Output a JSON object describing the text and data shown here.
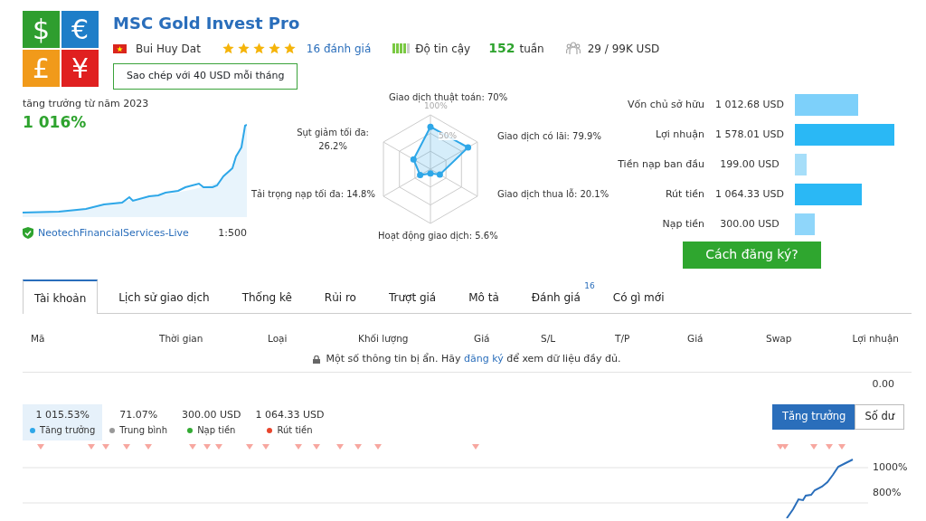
{
  "logo": {
    "symbols": [
      "$",
      "€",
      "£",
      "¥"
    ]
  },
  "header": {
    "title": "MSC Gold Invest Pro",
    "author": "Bui Huy Dat",
    "stars": 5,
    "reviews": "16 đánh giá",
    "reliability_label": "Độ tin cậy",
    "weeks_value": "152",
    "weeks_unit": "tuần",
    "subscribers": "29 / 99K USD",
    "copy_button": "Sao chép với 40 USD mỗi tháng"
  },
  "growth": {
    "caption": "tăng trưởng từ năm 2023",
    "value": "1 016%",
    "broker": "NeotechFinancialServices-Live",
    "leverage": "1:500"
  },
  "radar": {
    "grid_labels": [
      "100%",
      "50%"
    ],
    "axes": [
      {
        "label": "Giao dịch thuật toán: 70%"
      },
      {
        "label": "Sụt giảm tối đa:\n26.2%"
      },
      {
        "label": "Giao dịch có lãi: 79.9%"
      },
      {
        "label": "Tải trọng nạp tối đa: 14.8%"
      },
      {
        "label": "Giao dịch thua lỗ: 20.1%"
      },
      {
        "label": "Hoạt động giao dịch: 5.6%"
      }
    ]
  },
  "stats": [
    {
      "label": "Vốn chủ sở hữu",
      "value": "1 012.68 USD",
      "color": "#7dd0fa"
    },
    {
      "label": "Lợi nhuận",
      "value": "1 578.01 USD",
      "color": "#2ab8f5"
    },
    {
      "label": "Tiền nạp ban đầu",
      "value": "199.00 USD",
      "color": "#a6def9"
    },
    {
      "label": "Rút tiền",
      "value": "1 064.33 USD",
      "color": "#2ab8f5"
    },
    {
      "label": "Nạp tiền",
      "value": "300.00 USD",
      "color": "#8fd6fa"
    }
  ],
  "signup_button": "Cách đăng ký?",
  "tabs": [
    {
      "label": "Tài khoản",
      "selected": true
    },
    {
      "label": "Lịch sử giao dịch",
      "selected": false
    },
    {
      "label": "Thống kê",
      "selected": false
    },
    {
      "label": "Rủi ro",
      "selected": false
    },
    {
      "label": "Trượt giá",
      "selected": false
    },
    {
      "label": "Mô tả",
      "selected": false
    },
    {
      "label": "Đánh giá",
      "selected": false,
      "badge": "16"
    },
    {
      "label": "Có gì mới",
      "selected": false
    }
  ],
  "table": {
    "columns": [
      "Mã",
      "Thời gian",
      "Loại",
      "Khối lượng",
      "Giá",
      "S/L",
      "T/P",
      "Giá",
      "Swap",
      "Lợi nhuận"
    ],
    "notice_before": "Một số thông tin bị ẩn. Hãy",
    "notice_link": "đăng ký",
    "notice_after": "để xem dữ liệu đầy đủ.",
    "total": "0.00"
  },
  "legend": [
    {
      "value": "1 015.53%",
      "label": "Tăng trưởng",
      "color": "#2ea7e8",
      "selected": true
    },
    {
      "value": "71.07%",
      "label": "Trung bình",
      "color": "#999999",
      "selected": false
    },
    {
      "value": "300.00 USD",
      "label": "Nạp tiền",
      "color": "#33aa33",
      "selected": false
    },
    {
      "value": "1 064.33 USD",
      "label": "Rút tiền",
      "color": "#e8452c",
      "selected": false
    }
  ],
  "view_toggle": [
    {
      "label": "Tăng trưởng",
      "selected": true
    },
    {
      "label": "Số dư",
      "selected": false
    }
  ],
  "chart": {
    "axis_labels": [
      "1000%",
      "800%"
    ]
  }
}
